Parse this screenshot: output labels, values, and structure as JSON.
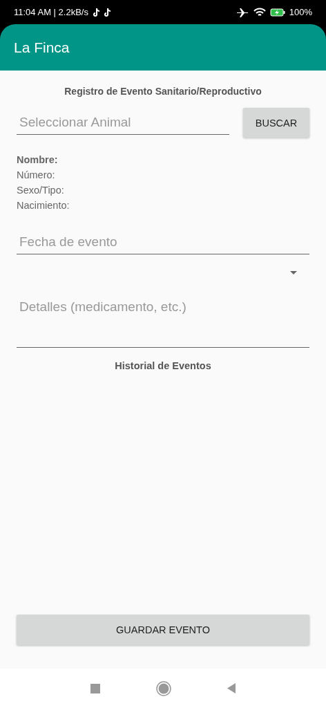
{
  "status_bar": {
    "time": "11:04 AM | 2.2kB/s",
    "battery": "100%"
  },
  "app_bar": {
    "title": "La Finca"
  },
  "form": {
    "title": "Registro de Evento Sanitario/Reproductivo",
    "animal_field": {
      "placeholder": "Seleccionar Animal"
    },
    "search_button": "BUSCAR",
    "info": [
      {
        "label": "Nombre:",
        "bold": true
      },
      {
        "label": "Número:",
        "bold": false
      },
      {
        "label": "Sexo/Tipo:",
        "bold": false
      },
      {
        "label": "Nacimiento:",
        "bold": false
      }
    ],
    "date_field": {
      "placeholder": "Fecha de evento"
    },
    "details_field": {
      "placeholder": "Detalles (medicamento, etc.)"
    },
    "history_title": "Historial de Eventos",
    "save_button": "GUARDAR EVENTO"
  }
}
